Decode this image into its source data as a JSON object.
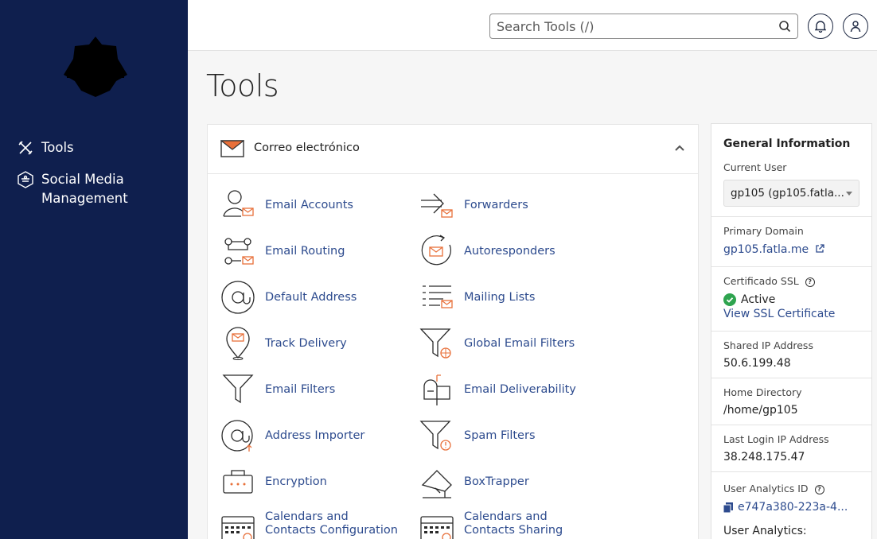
{
  "sidebar": {
    "logo": "shield-badge-logo",
    "items": [
      {
        "label": "Tools",
        "icon": "tools-icon"
      },
      {
        "label": "Social Media\nManagement",
        "icon": "social-media-icon"
      }
    ]
  },
  "topbar": {
    "search_placeholder": "Search Tools (/)",
    "notifications_icon": "bell-icon",
    "user_icon": "user-icon"
  },
  "page": {
    "title": "Tools"
  },
  "email_panel": {
    "title": "Correo electrónico",
    "tools": [
      {
        "label": "Email Accounts",
        "icon": "email-accounts-icon"
      },
      {
        "label": "Forwarders",
        "icon": "forwarders-icon"
      },
      {
        "label": "Email Routing",
        "icon": "email-routing-icon"
      },
      {
        "label": "Autoresponders",
        "icon": "autoresponders-icon"
      },
      {
        "label": "Default Address",
        "icon": "at-sign-icon"
      },
      {
        "label": "Mailing Lists",
        "icon": "mailing-lists-icon"
      },
      {
        "label": "Track Delivery",
        "icon": "track-delivery-icon"
      },
      {
        "label": "Global Email Filters",
        "icon": "global-filter-icon"
      },
      {
        "label": "Email Filters",
        "icon": "filter-icon"
      },
      {
        "label": "Email Deliverability",
        "icon": "mailbox-icon"
      },
      {
        "label": "Address Importer",
        "icon": "address-importer-icon"
      },
      {
        "label": "Spam Filters",
        "icon": "spam-filter-icon"
      },
      {
        "label": "Encryption",
        "icon": "encryption-icon"
      },
      {
        "label": "BoxTrapper",
        "icon": "boxtrapper-icon"
      },
      {
        "label": "Calendars and Contacts Configuration",
        "icon": "calendar-config-icon"
      },
      {
        "label": "Calendars and Contacts Sharing",
        "icon": "calendar-sharing-icon"
      }
    ]
  },
  "info": {
    "heading": "General Information",
    "current_user_label": "Current User",
    "current_user_value": "gp105 (gp105.fatla...",
    "primary_domain_label": "Primary Domain",
    "primary_domain_value": "gp105.fatla.me",
    "ssl_label": "Certificado SSL",
    "ssl_status": "Active",
    "ssl_link": "View SSL Certificate",
    "shared_ip_label": "Shared IP Address",
    "shared_ip_value": "50.6.199.48",
    "home_dir_label": "Home Directory",
    "home_dir_value": "/home/gp105",
    "last_login_label": "Last Login IP Address",
    "last_login_value": "38.248.175.47",
    "analytics_id_label": "User Analytics ID",
    "analytics_id_value": "e747a380-223a-4...",
    "analytics_label": "User Analytics:"
  },
  "colors": {
    "sidebar_bg": "#0f1f4e",
    "link": "#2d4b8e",
    "accent_orange": "#e8703a",
    "success_green": "#2ea44f"
  }
}
